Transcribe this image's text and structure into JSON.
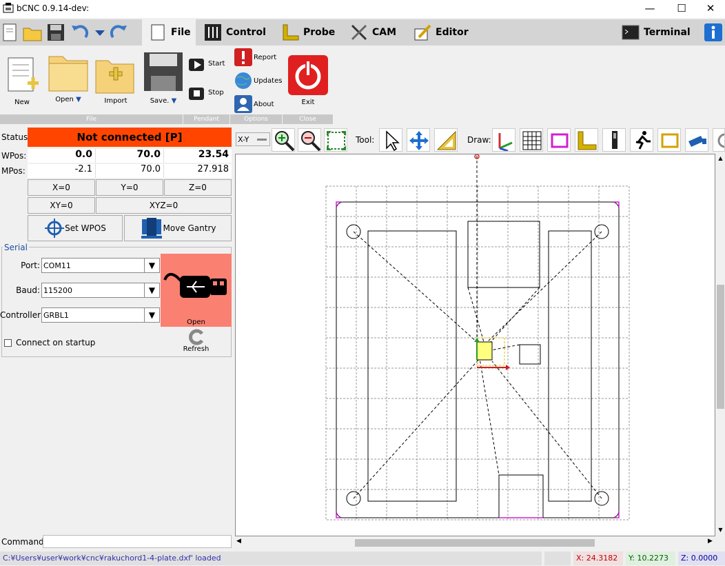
{
  "window": {
    "title": "bCNC 0.9.14-dev:",
    "icons": [
      "app-icon",
      "minimize-icon",
      "maximize-icon",
      "close-icon"
    ]
  },
  "tabs": [
    {
      "label": "File"
    },
    {
      "label": "Control"
    },
    {
      "label": "Probe"
    },
    {
      "label": "CAM"
    },
    {
      "label": "Editor"
    },
    {
      "label": "Terminal"
    }
  ],
  "ribbon": {
    "file": {
      "group": "File",
      "new": "New",
      "open": "Open",
      "import": "Import",
      "save": "Save."
    },
    "pendant": {
      "group": "Pendant",
      "start": "Start",
      "stop": "Stop"
    },
    "options": {
      "group": "Options",
      "report": "Report",
      "updates": "Updates",
      "about": "About"
    },
    "close": {
      "group": "Close",
      "exit": "Exit"
    }
  },
  "status": {
    "label": "Status:",
    "value": "Not connected [P]",
    "color": "#ff4500"
  },
  "wpos": {
    "label": "WPos:",
    "x": "0.0",
    "y": "70.0",
    "z": "23.54"
  },
  "mpos": {
    "label": "MPos:",
    "x": "-2.1",
    "y": "70.0",
    "z": "27.918"
  },
  "zero": {
    "x": "X=0",
    "y": "Y=0",
    "z": "Z=0",
    "xy": "XY=0",
    "xyz": "XYZ=0"
  },
  "actions": {
    "set_wpos": "Set WPOS",
    "move_gantry": "Move Gantry"
  },
  "serial": {
    "title": "Serial",
    "port_label": "Port:",
    "port": "COM11",
    "baud_label": "Baud:",
    "baud": "115200",
    "controller_label": "Controller:",
    "controller": "GRBL1",
    "connect_label": "Connect on startup",
    "connect_checked": false,
    "open_label": "Open",
    "refresh_label": "Refresh",
    "open_color": "#fa8072"
  },
  "canvas_toolbar": {
    "view": "X-Y",
    "tool_label": "Tool:",
    "draw_label": "Draw:"
  },
  "command": {
    "label": "Command:",
    "value": ""
  },
  "statusbar": {
    "message": "C:¥Users¥user¥work¥cnc¥rakuchord1-4-plate.dxf' loaded",
    "x": "X: 24.3182",
    "y": "Y: 10.2273",
    "z": "Z: 0.0000"
  }
}
